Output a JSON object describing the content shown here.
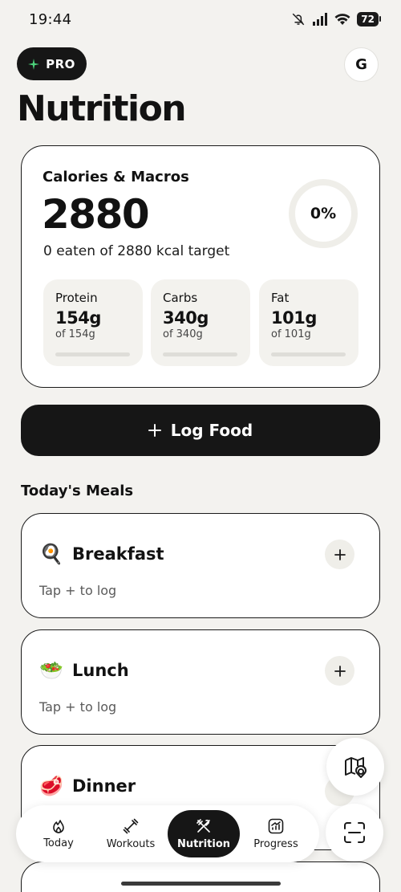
{
  "status_bar": {
    "time": "19:44",
    "battery": "72"
  },
  "header": {
    "pro_label": "PRO",
    "avatar_initial": "G",
    "title": "Nutrition"
  },
  "calories": {
    "title": "Calories & Macros",
    "value": "2880",
    "subtitle": "0 eaten of 2880 kcal target",
    "progress_label": "0%",
    "progress_fraction": 0
  },
  "macros": [
    {
      "label": "Protein",
      "value": "154g",
      "target": "of 154g",
      "fraction": 0
    },
    {
      "label": "Carbs",
      "value": "340g",
      "target": "of 340g",
      "fraction": 0
    },
    {
      "label": "Fat",
      "value": "101g",
      "target": "of 101g",
      "fraction": 0
    }
  ],
  "log_food": {
    "label": "Log Food"
  },
  "meals": {
    "section_title": "Today's Meals",
    "items": [
      {
        "emoji": "🍳",
        "name": "Breakfast",
        "hint": "Tap + to log"
      },
      {
        "emoji": "🥗",
        "name": "Lunch",
        "hint": "Tap + to log"
      },
      {
        "emoji": "🥩",
        "name": "Dinner",
        "hint": ""
      }
    ]
  },
  "tabbar": {
    "tabs": [
      {
        "label": "Today",
        "icon": "flame-icon"
      },
      {
        "label": "Workouts",
        "icon": "dumbbell-icon"
      },
      {
        "label": "Nutrition",
        "icon": "fork-knife-icon",
        "active": true
      },
      {
        "label": "Progress",
        "icon": "chart-icon"
      }
    ]
  },
  "fabs": {
    "map": "map-pin-icon",
    "scan": "scan-icon"
  }
}
